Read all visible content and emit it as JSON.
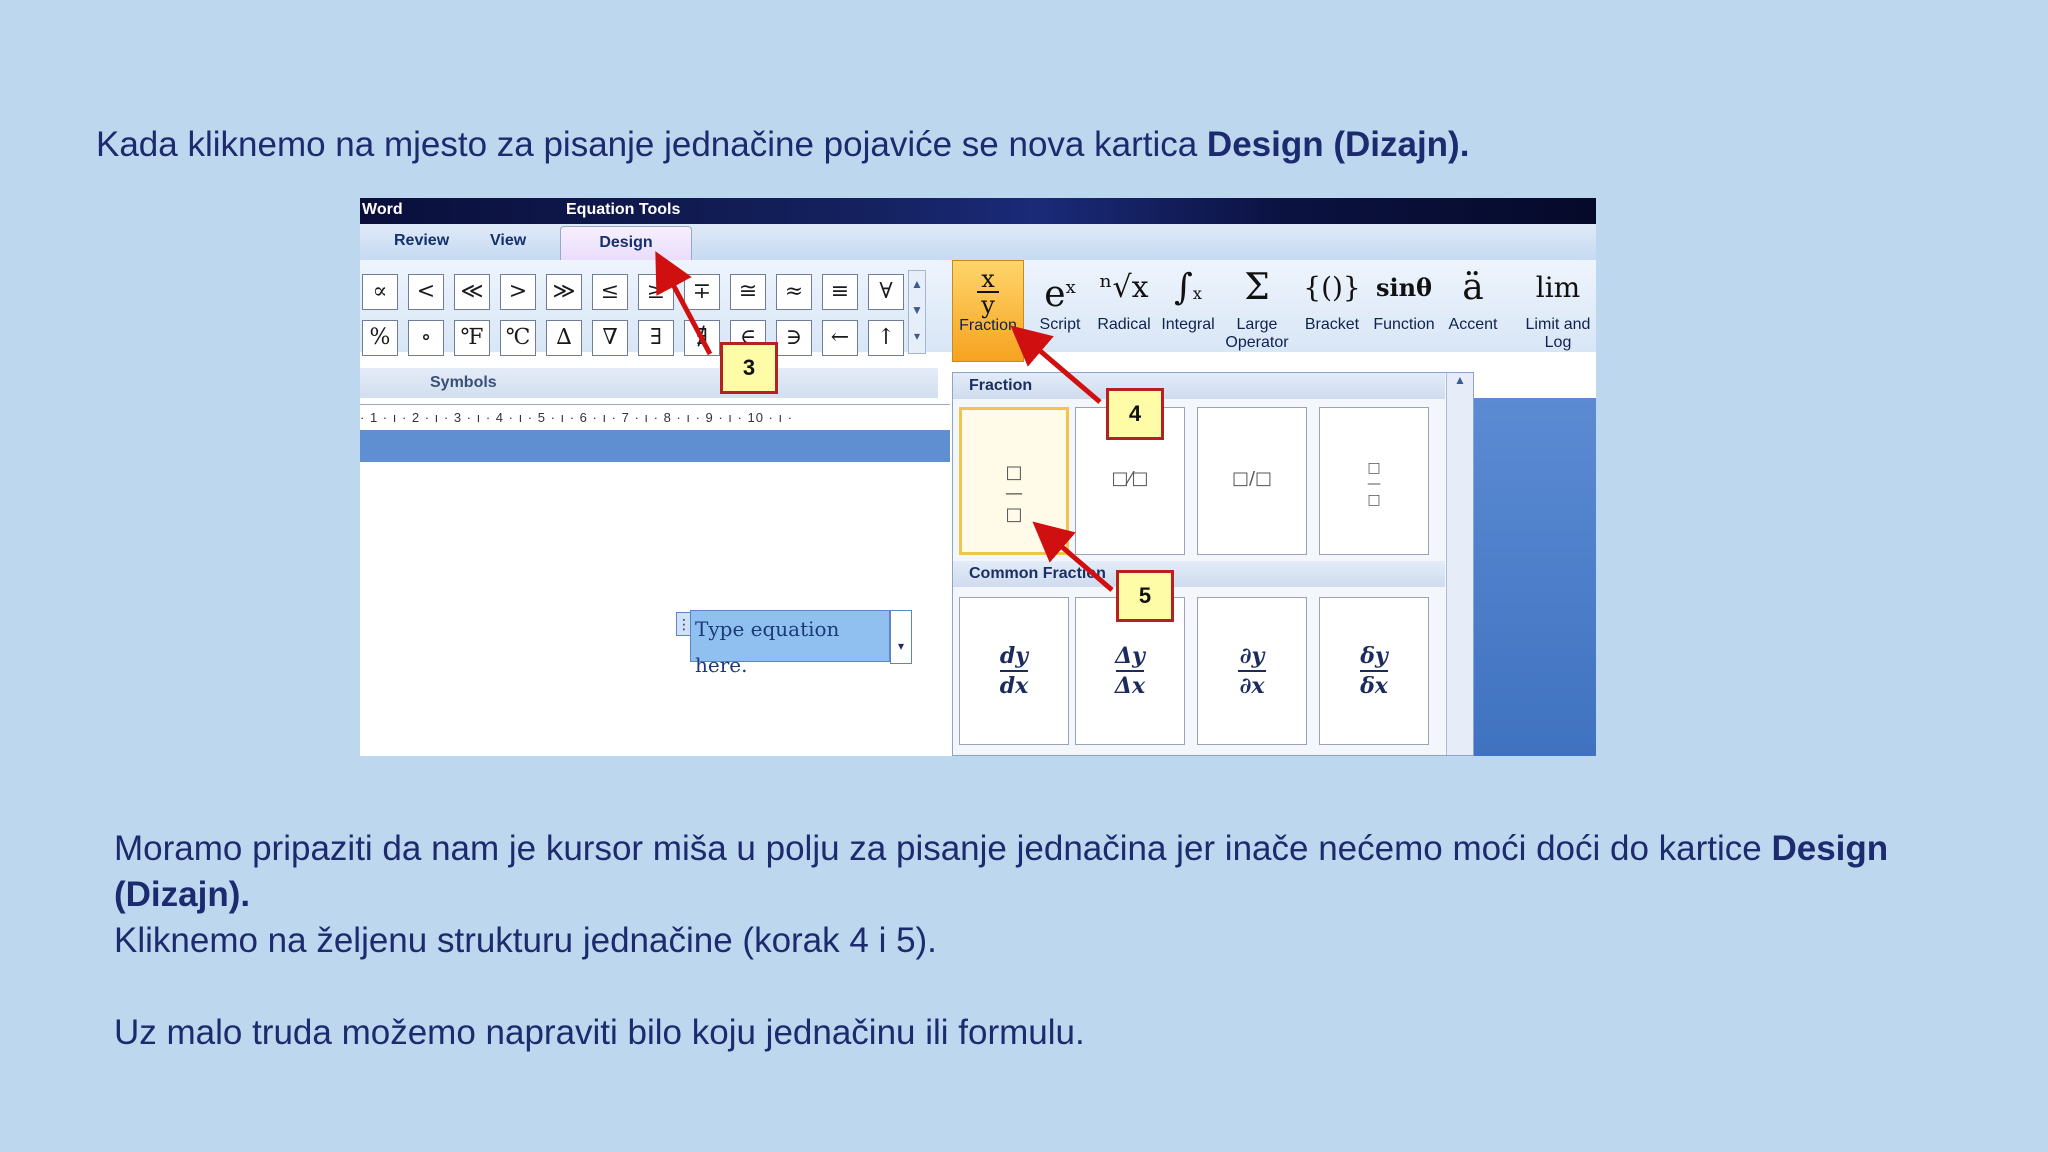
{
  "slide": {
    "intro": {
      "text": "Kada kliknemo na mjesto za pisanje jednačine pojaviće se nova kartica ",
      "bold": "Design (Dizajn)."
    },
    "notes": {
      "line1_text": "Moramo pripaziti da nam je kursor miša u polju za pisanje jednačina jer inače nećemo moći doći do kartice ",
      "line1_bold": "Design (Dizajn).",
      "line2": "Kliknemo na željenu strukturu jednačine (korak 4 i 5).",
      "line3": "Uz malo truda možemo napraviti bilo koju jednačinu ili formulu."
    }
  },
  "screenshot": {
    "title_app": "Word",
    "title_tools": "Equation Tools",
    "tabs": {
      "review": "Review",
      "view": "View",
      "design": "Design"
    },
    "symbols_row1": [
      "∝",
      "<",
      "≪",
      ">",
      "≫",
      "≤",
      "≥",
      "∓",
      "≅",
      "≈",
      "≡",
      "∀"
    ],
    "symbols_row2": [
      "%",
      "∘",
      "℉",
      "℃",
      "∆",
      "∇",
      "∃",
      "∄",
      "∈",
      "∋",
      "←",
      "↑"
    ],
    "symbols_label": "Symbols",
    "ribbon": {
      "fraction": "Fraction",
      "script": "Script",
      "radical": "Radical",
      "integral": "Integral",
      "large_operator": "Large Operator",
      "bracket": "Bracket",
      "function": "Function",
      "accent": "Accent",
      "limit": "Limit and Log"
    },
    "ruler": "· 1 · ı · 2 · ı · 3 · ı · 4 · ı · 5 · ı · 6 · ı · 7 · ı · 8 · ı · 9 · ı · 10 · ı ·",
    "equation_placeholder": "Type equation here.",
    "gallery": {
      "fraction_header": "Fraction",
      "common_header": "Common Fraction",
      "common": [
        {
          "num": "dy",
          "den": "dx"
        },
        {
          "num": "Δy",
          "den": "Δx"
        },
        {
          "num": "∂y",
          "den": "∂x"
        },
        {
          "num": "δy",
          "den": "δx"
        }
      ]
    },
    "callouts": {
      "c3": "3",
      "c4": "4",
      "c5": "5"
    }
  }
}
